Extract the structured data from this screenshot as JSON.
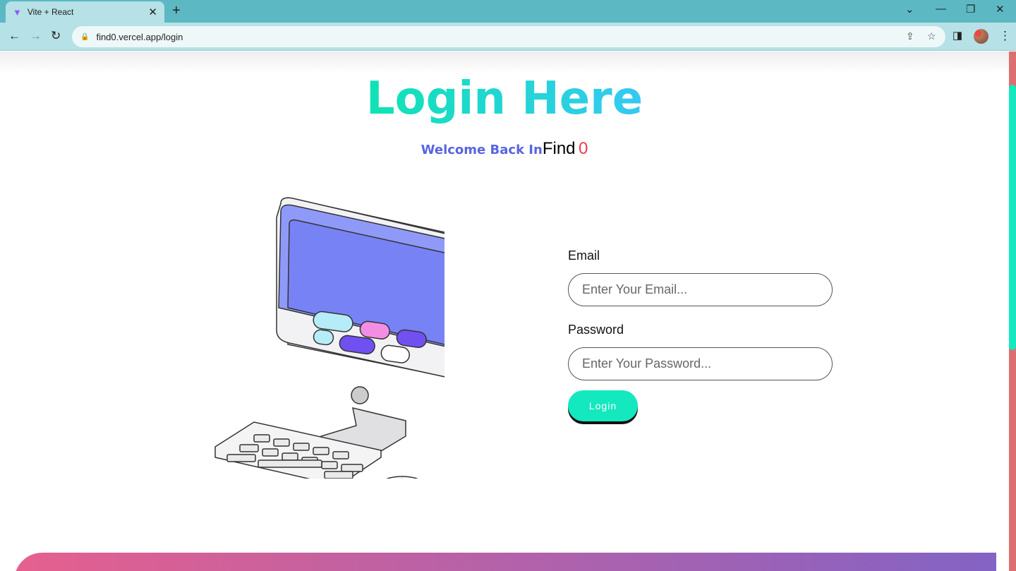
{
  "browser": {
    "tab_title": "Vite + React",
    "url": "find0.vercel.app/login"
  },
  "page": {
    "title": "Login Here",
    "welcome": "Welcome Back In",
    "brand_find": "Find",
    "brand_zero": "0",
    "email_label": "Email",
    "email_placeholder": "Enter Your Email...",
    "password_label": "Password",
    "password_placeholder": "Enter Your Password...",
    "login_button": "Login"
  },
  "colors": {
    "accent": "#14e8bf",
    "brand_red": "#f0384f",
    "welcome_blue": "#5865e0",
    "screen": "#7782f5"
  }
}
